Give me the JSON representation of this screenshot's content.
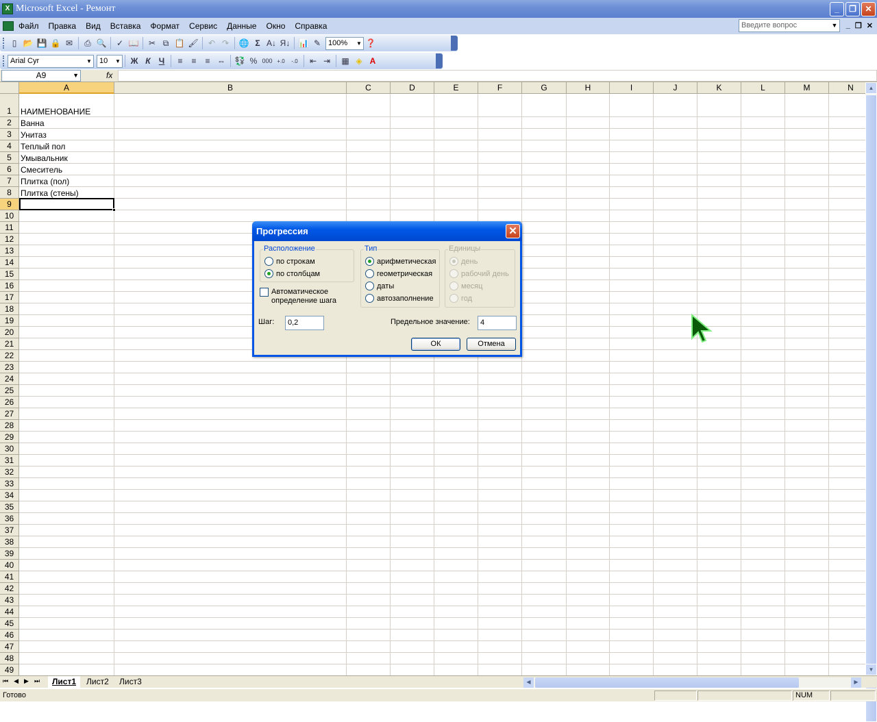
{
  "window": {
    "title": "Microsoft Excel - Ремонт",
    "min": "_",
    "restore": "❐",
    "close": "✕"
  },
  "menu": {
    "items": [
      "Файл",
      "Правка",
      "Вид",
      "Вставка",
      "Формат",
      "Сервис",
      "Данные",
      "Окно",
      "Справка"
    ],
    "ask_placeholder": "Введите вопрос",
    "mdi": [
      "_",
      "❐",
      "✕"
    ]
  },
  "toolbar": {
    "zoom": "100%",
    "font": "Arial Cyr",
    "size": "10",
    "bold": "Ж",
    "italic": "К",
    "underline": "Ч"
  },
  "formula_bar": {
    "name_box": "A9",
    "fx": "fx",
    "value": ""
  },
  "columns": [
    "A",
    "B",
    "C",
    "D",
    "E",
    "F",
    "G",
    "H",
    "I",
    "J",
    "K",
    "L",
    "M",
    "N"
  ],
  "rows": [
    "1",
    "2",
    "3",
    "4",
    "5",
    "6",
    "7",
    "8",
    "9",
    "10",
    "11",
    "12",
    "13",
    "14",
    "15",
    "16",
    "17",
    "18",
    "19",
    "20",
    "21",
    "22",
    "23",
    "24",
    "25",
    "26",
    "27",
    "28",
    "29",
    "30",
    "31",
    "32",
    "33",
    "34",
    "35",
    "36",
    "37",
    "38",
    "39",
    "40",
    "41",
    "42",
    "43",
    "44",
    "45",
    "46",
    "47",
    "48",
    "49"
  ],
  "cells": {
    "A1": "НАИМЕНОВАНИЕ",
    "A2": "Ванна",
    "A3": "Унитаз",
    "A4": "Теплый пол",
    "A5": "Умывальник",
    "A6": "Смеситель",
    "A7": "Плитка (пол)",
    "A8": "Плитка (стены)"
  },
  "active_cell": "A9",
  "sheets": [
    "Лист1",
    "Лист2",
    "Лист3"
  ],
  "active_sheet": "Лист1",
  "status": {
    "text": "Готово",
    "num": "NUM"
  },
  "dialog": {
    "title": "Прогрессия",
    "layout_group": {
      "label": "Расположение",
      "options": [
        "по строкам",
        "по столбцам"
      ],
      "selected": "по столбцам"
    },
    "type_group": {
      "label": "Тип",
      "options": [
        "арифметическая",
        "геометрическая",
        "даты",
        "автозаполнение"
      ],
      "selected": "арифметическая"
    },
    "units_group": {
      "label": "Единицы",
      "options": [
        "день",
        "рабочий день",
        "месяц",
        "год"
      ],
      "selected": "день",
      "disabled": true
    },
    "auto_step": {
      "label1": "Автоматическое",
      "label2": "определение шага",
      "checked": false
    },
    "step_label": "Шаг:",
    "step_value": "0,2",
    "limit_label": "Предельное значение:",
    "limit_value": "4",
    "ok": "ОК",
    "cancel": "Отмена"
  }
}
